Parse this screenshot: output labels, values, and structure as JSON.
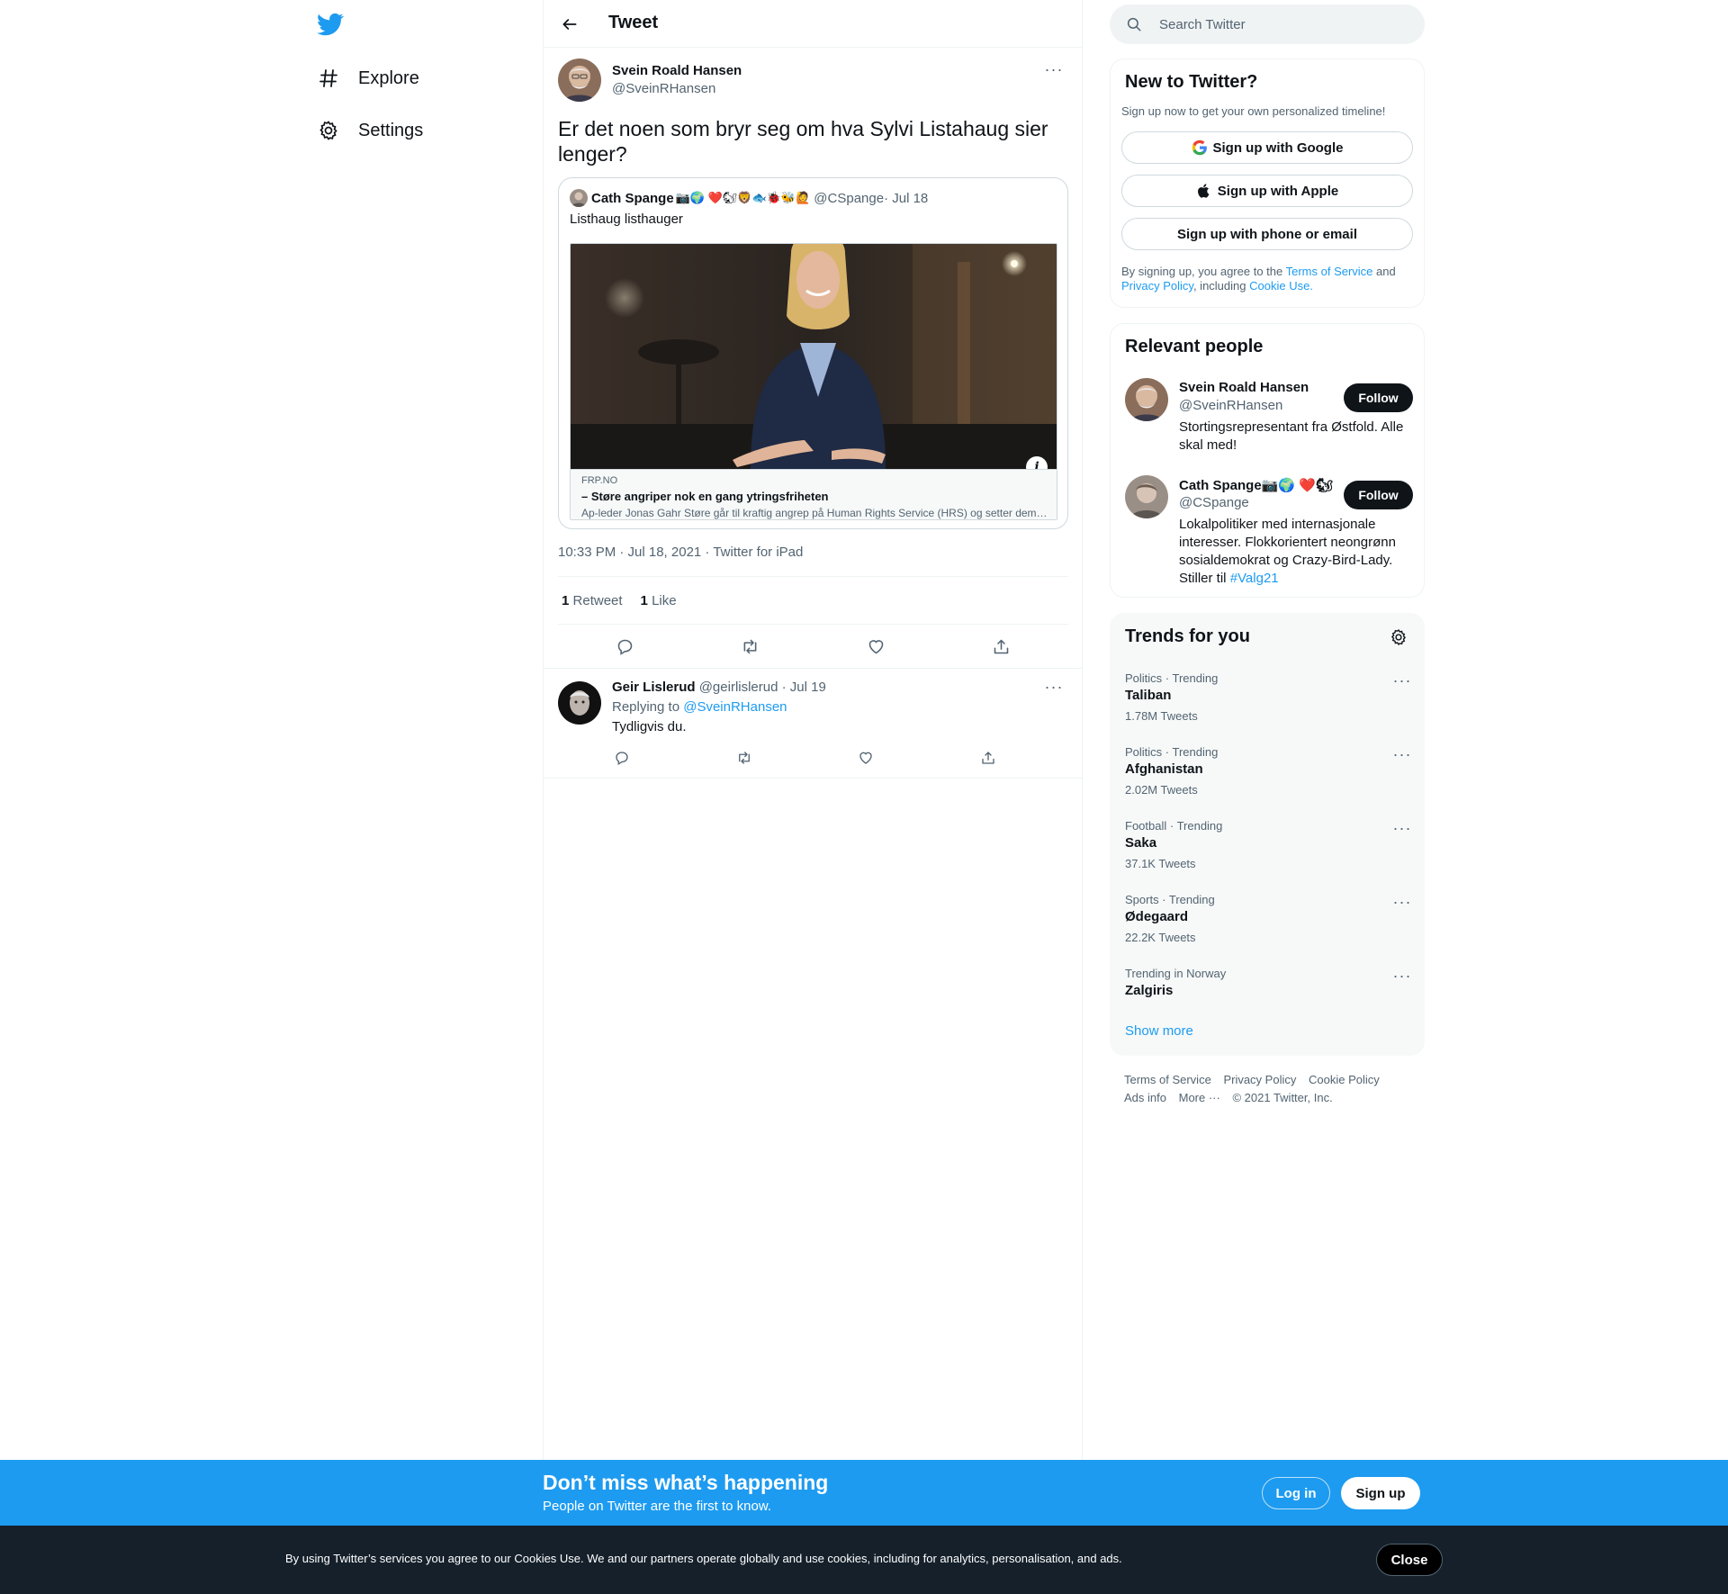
{
  "nav": {
    "items": [
      {
        "label": "Explore",
        "icon": "hashtag-icon"
      },
      {
        "label": "Settings",
        "icon": "gear-icon"
      }
    ]
  },
  "header": {
    "title": "Tweet"
  },
  "main_tweet": {
    "name": "Svein Roald Hansen",
    "handle": "@SveinRHansen",
    "text": "Er det noen som bryr seg om hva Sylvi Listahaug sier lenger?",
    "meta": "10:33 PM · Jul 18, 2021 · Twitter for iPad",
    "retweets_count": "1",
    "retweets_label": "Retweet",
    "likes_count": "1",
    "likes_label": "Like"
  },
  "quote": {
    "name": "Cath Spange",
    "emoji": "📷🌍 ❤️🐿🦁🐟🐞🐝🙋",
    "handle": "@CSpange",
    "date": " · Jul 18",
    "text": "Listhaug listhauger",
    "card": {
      "domain": "FRP.NO",
      "title": "– Støre angriper nok en gang ytringsfriheten",
      "description": "Ap-leder Jonas Gahr Støre går til kraftig angrep på Human Rights Service (HRS) og setter dem ..."
    }
  },
  "reply": {
    "name": "Geir Lislerud",
    "handle": " @geirlislerud",
    "date": " · Jul 19",
    "replying_prefix": "Replying to ",
    "replying_to": "@SveinRHansen",
    "text": "Tydligvis du."
  },
  "search": {
    "placeholder": "Search Twitter"
  },
  "new_to_twitter": {
    "title": "New to Twitter?",
    "subtitle": "Sign up now to get your own personalized timeline!",
    "google_btn": "Sign up with Google",
    "apple_btn": "Sign up with Apple",
    "phone_btn": "Sign up with phone or email",
    "legal_1": "By signing up, you agree to the ",
    "legal_tos": "Terms of Service",
    "legal_2": " and ",
    "legal_privacy": "Privacy Policy",
    "legal_3": ", including ",
    "legal_cookie": "Cookie Use."
  },
  "relevant_people": {
    "title": "Relevant people",
    "follow_label": "Follow",
    "people": [
      {
        "name": "Svein Roald Hansen",
        "handle": "@SveinRHansen",
        "bio": "Stortingsrepresentant fra Østfold. Alle skal med!"
      },
      {
        "name": "Cath Spange📷🌍 ❤️🐿",
        "handle": "@CSpange",
        "bio_text": "Lokalpolitiker med internasjonale interesser. Flokkorientert neongrønn sosialdemokrat og Crazy-Bird-Lady. Stiller til ",
        "bio_link": "#Valg21"
      }
    ]
  },
  "trends": {
    "title": "Trends for you",
    "items": [
      {
        "context": "Politics · Trending",
        "name": "Taliban",
        "count": "1.78M Tweets"
      },
      {
        "context": "Politics · Trending",
        "name": "Afghanistan",
        "count": "2.02M Tweets"
      },
      {
        "context": "Football · Trending",
        "name": "Saka",
        "count": "37.1K Tweets"
      },
      {
        "context": "Sports · Trending",
        "name": "Ødegaard",
        "count": "22.2K Tweets"
      },
      {
        "context": "Trending in Norway",
        "name": "Zalgiris",
        "count": ""
      }
    ],
    "show_more": "Show more"
  },
  "footer": {
    "links": [
      "Terms of Service",
      "Privacy Policy",
      "Cookie Policy",
      "Ads info",
      "More ···"
    ],
    "copyright": "© 2021 Twitter, Inc."
  },
  "banner": {
    "title": "Don’t miss what’s happening",
    "subtitle": "People on Twitter are the first to know.",
    "login": "Log in",
    "signup": "Sign up"
  },
  "cookie": {
    "text": "By using Twitter’s services you agree to our Cookies Use. We and our partners operate globally and use cookies, including for analytics, personalisation, and ads.",
    "close": "Close"
  },
  "colors": {
    "accent": "#1d9bf0",
    "text": "#0f1419",
    "secondary": "#536471",
    "cookie_bg": "#15202b"
  }
}
